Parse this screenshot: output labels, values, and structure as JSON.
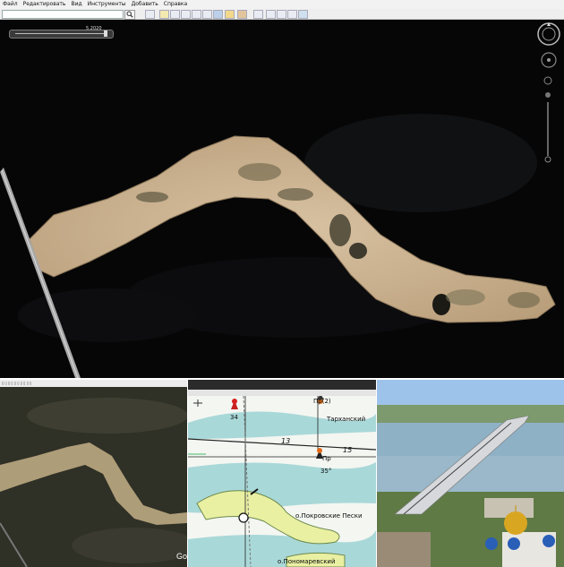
{
  "menu": [
    "Файл",
    "Редактировать",
    "Вид",
    "Инструменты",
    "Добавить",
    "Справка"
  ],
  "toolbar": {
    "search_icon": "magnifier-icon",
    "tools": [
      "sidebar-icon",
      "placemark-icon",
      "polygon-icon",
      "path-icon",
      "image-overlay-icon",
      "tour-icon",
      "historical-imagery-icon",
      "sun-icon",
      "planets-icon",
      "ruler-icon",
      "email-icon",
      "print-icon",
      "save-image-icon",
      "maps-icon"
    ]
  },
  "earth": {
    "time_slider_year": "5.2020",
    "colors": {
      "sand": "#cdb596",
      "water": "#060607",
      "vegetation": "#6e6648"
    }
  },
  "bottom_left": {
    "attribution": "Go"
  },
  "topo_map": {
    "labels": {
      "tarkhansky": "Тарханский",
      "pokrovskie": "о.Покровские Пески",
      "ponomarevsky": "о.Пономаревский",
      "pr2": "Пр(2)",
      "pr": "Пр",
      "elev_34": "34",
      "elev_35": "35°"
    },
    "grid_numbers": [
      "13",
      "15",
      "13",
      "15"
    ]
  },
  "photo": {
    "icon": "city-bridge-photo"
  }
}
